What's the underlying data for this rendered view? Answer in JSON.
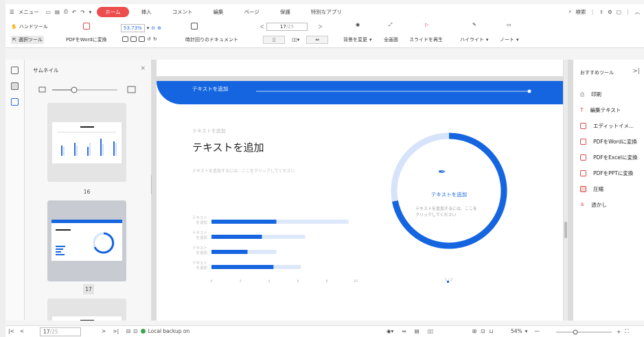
{
  "menubar": {
    "menu_label": "メニュー",
    "tabs": [
      "ホーム",
      "挿入",
      "コメント",
      "編集",
      "ページ",
      "保護",
      "特別なアプリ"
    ],
    "search_label": "検索"
  },
  "toolbar": {
    "hand_tool": "ハンドツール",
    "select_tool": "選択ツール",
    "pdf_to_word": "PDFをWordに変換",
    "zoom": "53.73%",
    "rotate": "時計回りのドキュメント",
    "page_current": "17",
    "page_total": "/25",
    "background": "背景を変更",
    "fullscreen": "全画面",
    "play": "スライドを再生",
    "highlight": "ハイライト",
    "note": "ノート"
  },
  "thumbs": {
    "title": "サムネイル",
    "pages": [
      {
        "num": "16"
      },
      {
        "num": "17"
      }
    ]
  },
  "page": {
    "banner": "テキストを追加",
    "subtitle": "テキストを追加",
    "heading": "テキストを追加",
    "desc": "テキストを追加するには、ここをクリックしてください",
    "circle_title": "テキストを追加",
    "circle_desc": "テキストを追加するには、ここをクリックしてください",
    "pager": "1 / 2"
  },
  "chart_data": {
    "type": "bar",
    "categories": [
      "テキスト を追加",
      "テキスト を追加",
      "テキスト を追加",
      "テキスト を追加"
    ],
    "series": [
      {
        "values": [
          4.5,
          3.5,
          2.5,
          4.3
        ]
      },
      {
        "values": [
          9.5,
          6.5,
          4.5,
          6.2
        ]
      }
    ],
    "xticks": [
      "0",
      "2",
      "4",
      "6",
      "8",
      "10"
    ],
    "xlim": [
      0,
      10
    ]
  },
  "donut": {
    "value": 0.72
  },
  "right": {
    "title": "おすすめツール",
    "items": [
      "印刷",
      "編集テキスト",
      "エディットイメ...",
      "PDFをWordに変換",
      "PDFをExcelに変換",
      "PDFをPPTに変換",
      "圧縮",
      "透かし"
    ]
  },
  "status": {
    "page_current": "17",
    "page_total": "/25",
    "backup": "Local backup on",
    "zoom": "54%"
  }
}
